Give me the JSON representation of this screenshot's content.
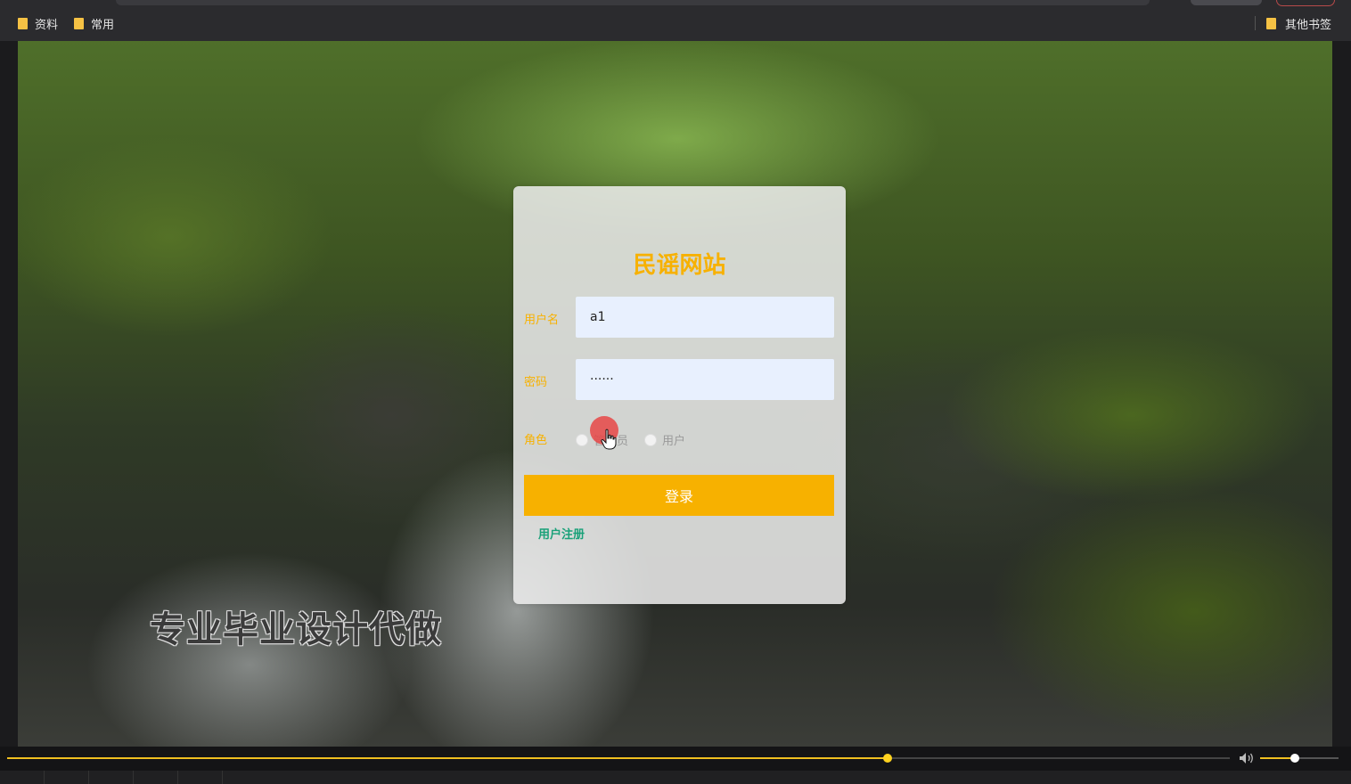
{
  "bookmarks": {
    "items": [
      {
        "label": "资料",
        "icon": "folder-icon"
      },
      {
        "label": "常用",
        "icon": "folder-icon"
      }
    ],
    "other_label": "其他书签"
  },
  "login": {
    "title": "民谣网站",
    "username_label": "用户名",
    "username_value": "a1",
    "password_label": "密码",
    "password_value": "······",
    "role_label": "角色",
    "role_options": [
      "管理员",
      "用户"
    ],
    "login_button": "登录",
    "register_link": "用户注册"
  },
  "watermark": "专业毕业设计代做",
  "player": {
    "progress": 0.72,
    "volume": 0.44
  },
  "colors": {
    "accent": "#f7b100",
    "link": "#1aa179",
    "input_bg": "#e8f0fe"
  }
}
